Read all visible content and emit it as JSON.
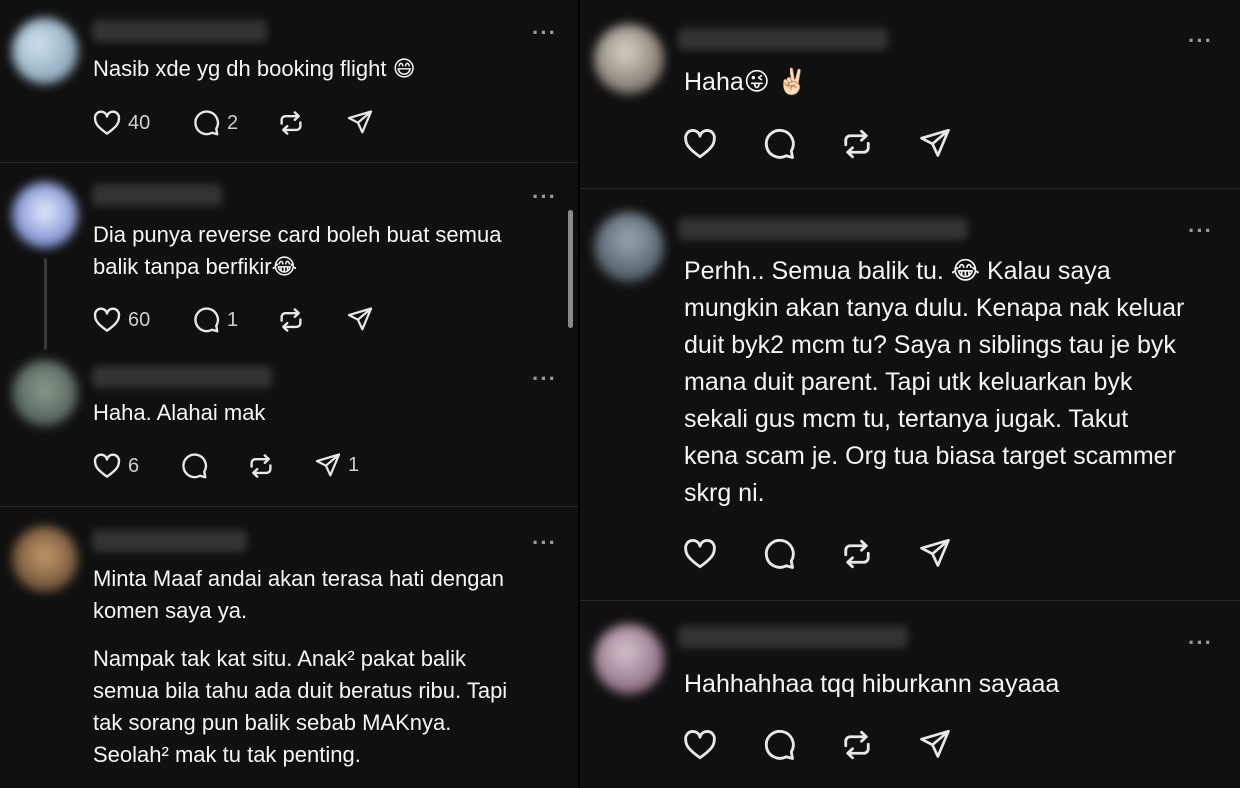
{
  "left": {
    "posts": [
      {
        "text": "Nasib xde yg dh booking flight 😄",
        "likes": "40",
        "replies": "2",
        "shares": ""
      },
      {
        "text": "Dia punya reverse card boleh buat semua\nbalik tanpa berfikir😂",
        "likes": "60",
        "replies": "1",
        "shares": ""
      },
      {
        "text": "Haha. Alahai mak",
        "likes": "6",
        "replies": "",
        "shares": "1"
      },
      {
        "text": "Minta Maaf andai akan terasa hati dengan\nkomen saya ya.",
        "text2": "Nampak tak kat situ. Anak² pakat balik\nsemua bila tahu ada duit beratus ribu. Tapi\ntak sorang pun balik sebab MAKnya.\nSeolah² mak tu tak penting."
      }
    ]
  },
  "right": {
    "posts": [
      {
        "text": "Haha😜 ✌🏻"
      },
      {
        "text": "Perhh.. Semua balik tu. 😂 Kalau saya\nmungkin akan tanya dulu. Kenapa nak keluar\nduit byk2 mcm tu? Saya n siblings tau je byk\nmana duit parent. Tapi utk keluarkan byk\nsekali gus mcm tu, tertanya jugak. Takut\nkena scam je. Org tua biasa target scammer\nskrg ni."
      },
      {
        "text": "Hahhahhaa tqq hiburkann sayaaa"
      }
    ]
  },
  "icons": [
    "heart-icon",
    "comment-icon",
    "repost-icon",
    "share-icon",
    "more-icon"
  ],
  "colors": {
    "background": "#101010",
    "text": "#f3f5f7",
    "muted": "#9a9a9e",
    "divider": "#2a2a2c"
  }
}
